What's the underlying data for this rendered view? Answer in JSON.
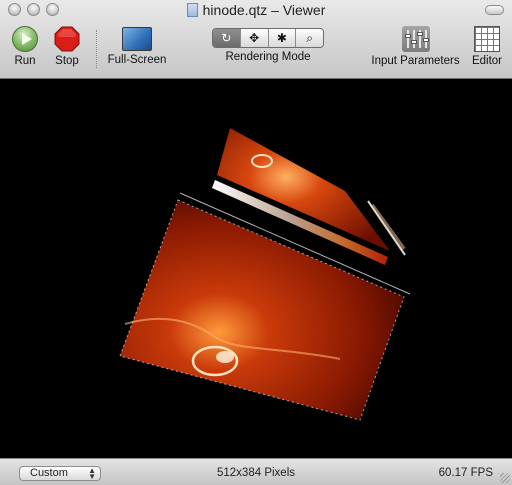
{
  "window": {
    "title": "hinode.qtz – Viewer"
  },
  "toolbar": {
    "run_label": "Run",
    "stop_label": "Stop",
    "fullscreen_label": "Full-Screen",
    "rendering_mode_label": "Rendering Mode",
    "rendering_modes": [
      "↻",
      "✥",
      "✱",
      "⌕"
    ],
    "input_parameters_label": "Input Parameters",
    "editor_label": "Editor"
  },
  "status": {
    "mode_value": "Custom",
    "resolution": "512x384 Pixels",
    "fps": "60.17 FPS"
  },
  "colors": {
    "solar_dark": "#3b0700",
    "solar_mid": "#b82a05",
    "solar_bright": "#ff8a2a",
    "stop_red": "#d91e18",
    "run_green": "#6aa84f"
  },
  "icons": [
    "run-icon",
    "stop-icon",
    "fullscreen-icon",
    "rotate-icon",
    "move-icon",
    "bug-icon",
    "zoom-icon",
    "sliders-icon",
    "editor-grid-icon",
    "document-icon"
  ]
}
